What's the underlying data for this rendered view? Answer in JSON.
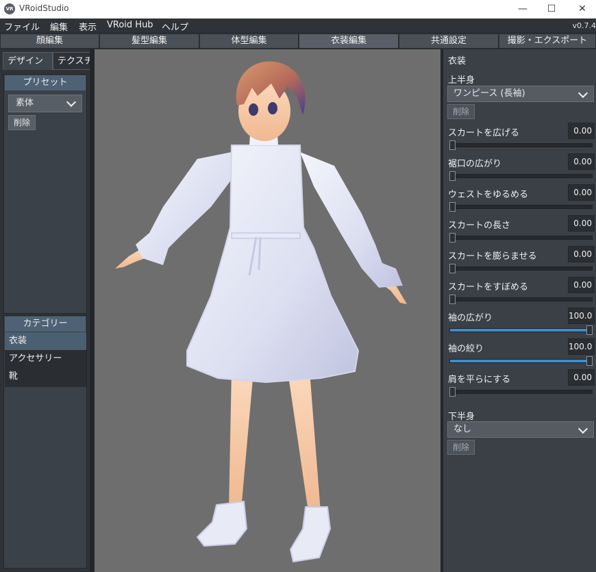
{
  "window": {
    "title": "VRoidStudio",
    "icon_text": "VR",
    "min_glyph": "—",
    "max_glyph": "☐",
    "close_glyph": "✕"
  },
  "menu": {
    "items": [
      "ファイル",
      "編集",
      "表示",
      "VRoid Hub",
      "ヘルプ"
    ],
    "version": "v0.7.4"
  },
  "tabs": [
    {
      "label": "顔編集",
      "active": false
    },
    {
      "label": "髪型編集",
      "active": false
    },
    {
      "label": "体型編集",
      "active": false
    },
    {
      "label": "衣装編集",
      "active": true
    },
    {
      "label": "共通設定",
      "active": false
    },
    {
      "label": "撮影・エクスポート",
      "active": false
    }
  ],
  "left_panel": {
    "tabs": {
      "design": "デザイン",
      "texture": "テクスチャ"
    },
    "preset": {
      "header": "プリセット",
      "selected": "素体",
      "delete_label": "削除"
    },
    "category": {
      "header": "カテゴリー",
      "items": [
        "衣装",
        "アクセサリー",
        "靴"
      ],
      "selected_index": 0
    }
  },
  "right_panel": {
    "title": "衣装",
    "upper": {
      "label": "上半身",
      "selected": "ワンピース (長袖)",
      "delete_label": "削除",
      "params": [
        {
          "label": "スカートを広げる",
          "value": "0.00",
          "fraction": 0
        },
        {
          "label": "裾口の広がり",
          "value": "0.00",
          "fraction": 0
        },
        {
          "label": "ウェストをゆるめる",
          "value": "0.00",
          "fraction": 0
        },
        {
          "label": "スカートの長さ",
          "value": "0.00",
          "fraction": 0
        },
        {
          "label": "スカートを膨らませる",
          "value": "0.00",
          "fraction": 0
        },
        {
          "label": "スカートをすぼめる",
          "value": "0.00",
          "fraction": 0
        },
        {
          "label": "袖の広がり",
          "value": "100.0",
          "fraction": 1
        },
        {
          "label": "袖の絞り",
          "value": "100.0",
          "fraction": 1
        },
        {
          "label": "肩を平らにする",
          "value": "0.00",
          "fraction": 0
        }
      ]
    },
    "lower": {
      "label": "下半身",
      "selected": "なし",
      "delete_label": "削除"
    }
  },
  "colors": {
    "accent": "#3b8ed0",
    "selected_item": "#4a6071",
    "header": "#4f6275",
    "viewport_bg": "#6e6e6e"
  }
}
